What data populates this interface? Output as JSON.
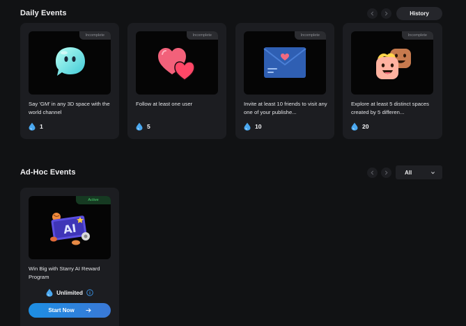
{
  "daily": {
    "title": "Daily Events",
    "history_label": "History",
    "cards": [
      {
        "status": "Incomplete",
        "desc": "Say 'GM' in any 3D space with the world channel",
        "reward": "1",
        "icon": "chat-bubble-icon"
      },
      {
        "status": "Incomplete",
        "desc": "Follow at least one user",
        "reward": "5",
        "icon": "hearts-icon"
      },
      {
        "status": "Incomplete",
        "desc": "Invite at least 10 friends to visit any one of your publishe...",
        "reward": "10",
        "icon": "envelope-icon"
      },
      {
        "status": "Incomplete",
        "desc": "Explore at least 5 distinct spaces created by 5 differen...",
        "reward": "20",
        "icon": "faces-icon"
      }
    ]
  },
  "adhoc": {
    "title": "Ad-Hoc Events",
    "filter_value": "All",
    "cards": [
      {
        "status": "Active",
        "desc": "Win Big with Starry AI Reward Program",
        "reward": "Unlimited",
        "cta": "Start Now",
        "art_text": "AI",
        "icon": "ai-banner-icon"
      }
    ]
  },
  "colors": {
    "background": "#111214",
    "card": "#1c1d21",
    "accent": "#2a8be6",
    "active_badge": "#4bd16f",
    "drop": "#4aa8f0"
  }
}
